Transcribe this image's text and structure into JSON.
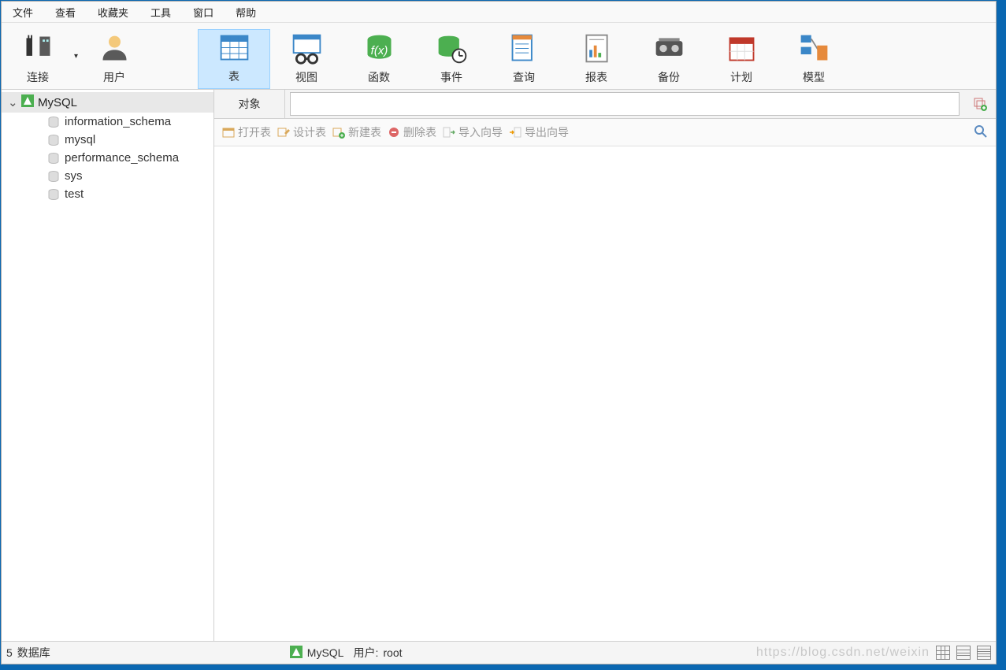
{
  "menu": {
    "items": [
      "文件",
      "查看",
      "收藏夹",
      "工具",
      "窗口",
      "帮助"
    ]
  },
  "toolbar": {
    "connect": "连接",
    "user": "用户",
    "table": "表",
    "view": "视图",
    "function": "函数",
    "event": "事件",
    "query": "查询",
    "report": "报表",
    "backup": "备份",
    "schedule": "计划",
    "model": "模型"
  },
  "sidebar": {
    "connection": "MySQL",
    "databases": [
      "information_schema",
      "mysql",
      "performance_schema",
      "sys",
      "test"
    ]
  },
  "objectbar": {
    "tab": "对象"
  },
  "actions": {
    "open": "打开表",
    "design": "设计表",
    "new": "新建表",
    "delete": "删除表",
    "import": "导入向导",
    "export": "导出向导"
  },
  "status": {
    "count": "5",
    "count_label": "数据库",
    "connection": "MySQL",
    "user_label": "用户:",
    "user_value": "root",
    "watermark": "https://blog.csdn.net/weixin"
  }
}
